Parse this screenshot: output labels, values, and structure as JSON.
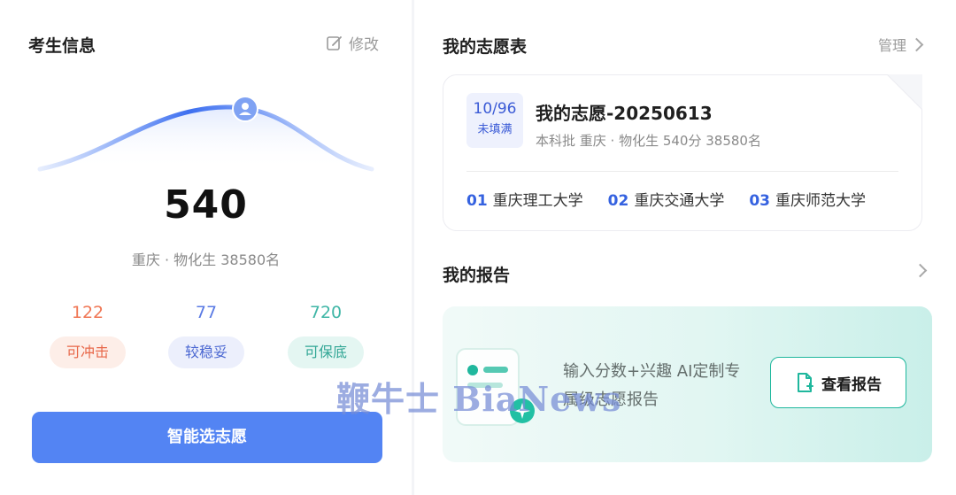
{
  "student": {
    "title": "考生信息",
    "edit_label": "修改",
    "score": "540",
    "detail": "重庆 · 物化生 38580名",
    "stats": [
      {
        "count": "122",
        "label": "可冲击",
        "color": "#f07755",
        "bg": "#fdeee8"
      },
      {
        "count": "77",
        "label": "较稳妥",
        "color": "#5a7ae4",
        "bg": "#eceffc"
      },
      {
        "count": "720",
        "label": "可保底",
        "color": "#3fb6a6",
        "bg": "#e4f6f2"
      }
    ],
    "cta": "智能选志愿"
  },
  "wishlist": {
    "title": "我的志愿表",
    "manage_label": "管理",
    "badge_count": "10/96",
    "badge_status": "未填满",
    "name": "我的志愿-20250613",
    "detail": "本科批 重庆 · 物化生 540分 38580名",
    "schools": [
      {
        "no": "01",
        "name": "重庆理工大学"
      },
      {
        "no": "02",
        "name": "重庆交通大学"
      },
      {
        "no": "03",
        "name": "重庆师范大学"
      }
    ]
  },
  "report": {
    "title": "我的报告",
    "promo_text": "输入分数+兴趣 AI定制专属级志愿报告",
    "button_label": "查看报告"
  },
  "watermark": "鞭牛士 BiaNews",
  "colors": {
    "accent": "#5384f3",
    "teal": "#1fb79d"
  }
}
